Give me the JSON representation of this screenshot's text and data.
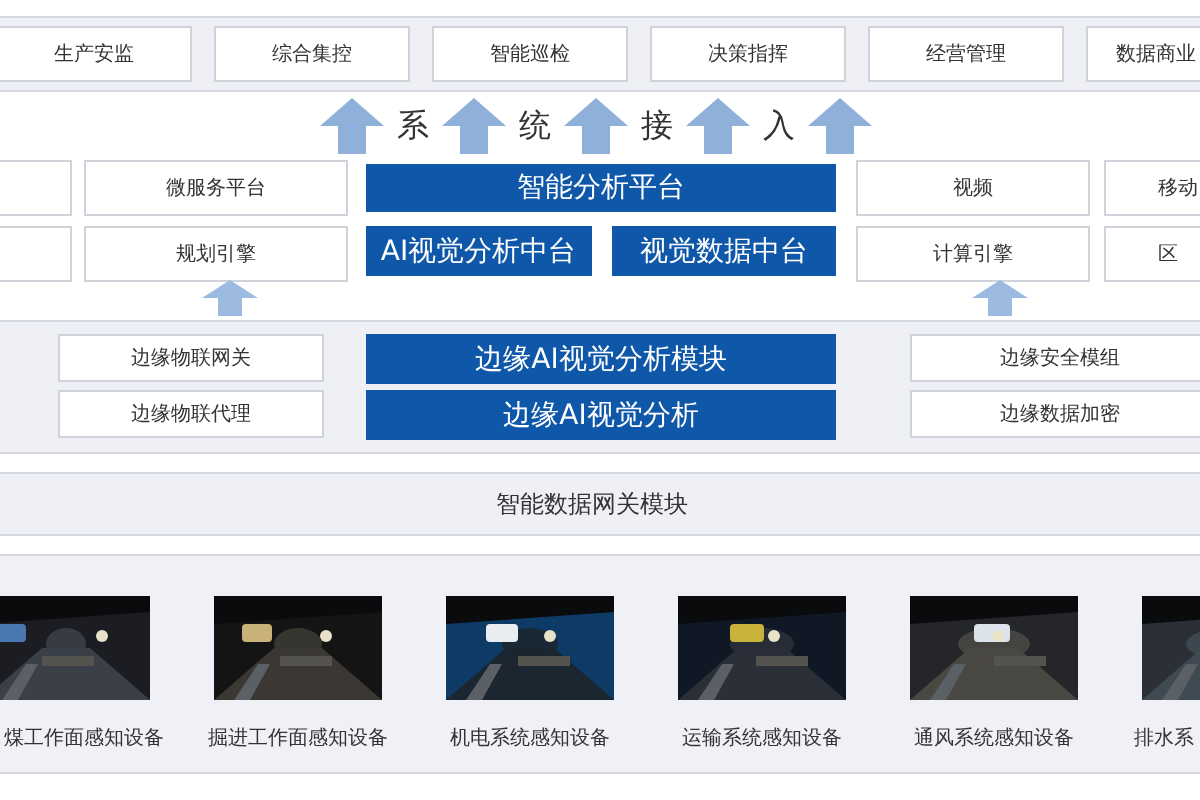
{
  "applications": [
    "生产安监",
    "综合集控",
    "智能巡检",
    "决策指挥",
    "经营管理",
    "数据商业"
  ],
  "access_label": [
    "系",
    "统",
    "接",
    "入"
  ],
  "platform": {
    "left": [
      "微服务平台",
      "规划引擎"
    ],
    "center_top": "智能分析平台",
    "center_bottom": [
      "AI视觉分析中台",
      "视觉数据中台"
    ],
    "right": [
      "视频",
      "计算引擎"
    ],
    "right_outer": [
      "移动",
      "区"
    ]
  },
  "edge": {
    "left": [
      "边缘物联网关",
      "边缘物联代理"
    ],
    "center": [
      "边缘AI视觉分析模块",
      "边缘AI视觉分析"
    ],
    "right": [
      "边缘安全模组",
      "边缘数据加密"
    ]
  },
  "gateway": "智能数据网关模块",
  "devices": [
    {
      "label": "煤工作面感知设备"
    },
    {
      "label": "掘进工作面感知设备"
    },
    {
      "label": "机电系统感知设备"
    },
    {
      "label": "运输系统感知设备"
    },
    {
      "label": "通风系统感知设备"
    },
    {
      "label": "排水系"
    }
  ]
}
